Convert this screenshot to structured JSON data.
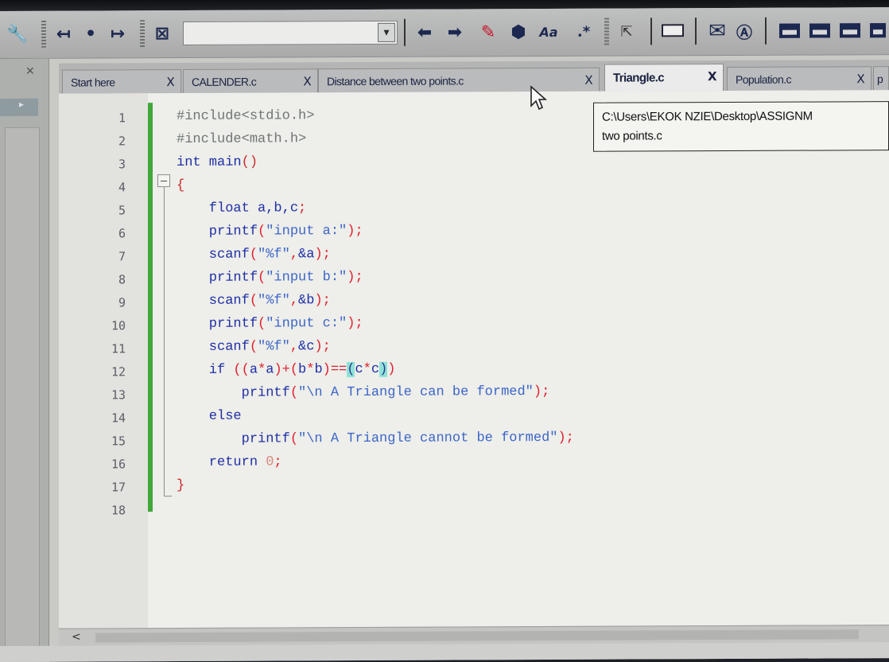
{
  "toolbar": {
    "icons": [
      "wrench-icon",
      "back-icon",
      "bullet-icon",
      "forward-icon",
      "stop-icon",
      "arrow-left-icon",
      "arrow-right-icon",
      "highlight-icon",
      "replace-icon",
      "match-case-icon",
      "regex-icon",
      "select-icon",
      "rect-icon",
      "mail-icon",
      "text-icon",
      "layout-icon"
    ],
    "search_value": "",
    "dropdown_glyph": "▾",
    "regex_label": ".*"
  },
  "tabs": [
    {
      "label": "Start here",
      "close": "X"
    },
    {
      "label": "CALENDER.c",
      "close": "X"
    },
    {
      "label": "Distance between two points.c",
      "close": "X"
    },
    {
      "label": "Triangle.c",
      "close": "X",
      "active": true
    },
    {
      "label": "Population.c",
      "close": "X"
    },
    {
      "label": "p"
    }
  ],
  "editor": {
    "lines": [
      "1",
      "2",
      "3",
      "4",
      "5",
      "6",
      "7",
      "8",
      "9",
      "10",
      "11",
      "12",
      "13",
      "14",
      "15",
      "16",
      "17",
      "18"
    ]
  },
  "tooltip": {
    "line1": "C:\\Users\\EKOK NZIE\\Desktop\\ASSIGNM",
    "line2": "two points.c"
  },
  "scrollbar": {
    "left_arrow": "<"
  }
}
